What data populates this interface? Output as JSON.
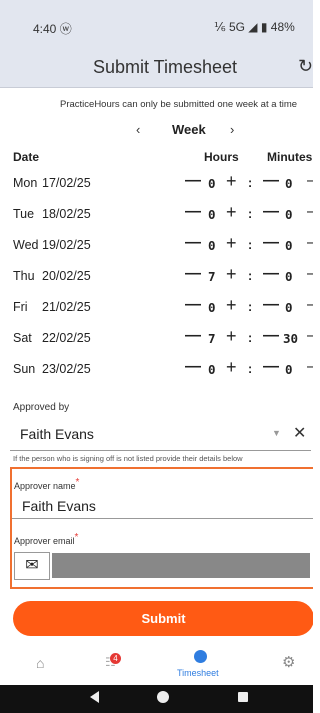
{
  "status_bar": {
    "time": "4:40 ⓦ",
    "right": "⅙ 5G ◢ ▮ 48%"
  },
  "app_bar": {
    "title": "Submit Timesheet",
    "refresh_icon": "↻"
  },
  "notice": "PracticeHours can only be submitted one week at a time",
  "week_nav": {
    "prev": "‹",
    "label": "Week",
    "next": "›"
  },
  "columns": {
    "date": "Date",
    "hours": "Hours",
    "minutes": "Minutes"
  },
  "controls": {
    "minus": "—",
    "plus": "+",
    "colon": ":"
  },
  "rows": [
    {
      "day": "Mon",
      "date": "17/02/25",
      "hours": "0",
      "minutes": "0"
    },
    {
      "day": "Tue",
      "date": "18/02/25",
      "hours": "0",
      "minutes": "0"
    },
    {
      "day": "Wed",
      "date": "19/02/25",
      "hours": "0",
      "minutes": "0"
    },
    {
      "day": "Thu",
      "date": "20/02/25",
      "hours": "7",
      "minutes": "0"
    },
    {
      "day": "Fri",
      "date": "21/02/25",
      "hours": "0",
      "minutes": "0"
    },
    {
      "day": "Sat",
      "date": "22/02/25",
      "hours": "7",
      "minutes": "30"
    },
    {
      "day": "Sun",
      "date": "23/02/25",
      "hours": "0",
      "minutes": "0"
    }
  ],
  "approved_by": {
    "label": "Approved by",
    "value": "Faith Evans",
    "dropdown_icon": "▼",
    "clear_icon": "✕",
    "hint": "If the person who is signing off is not listed provide their details below"
  },
  "approver": {
    "name_label": "Approver name",
    "required_mark": "*",
    "name_value": "Faith Evans",
    "email_label": "Approver email",
    "email_icon": "✉",
    "email_value": ""
  },
  "submit_label": "Submit",
  "bottom_nav": {
    "badge_count": "4",
    "timesheet_label": "Timesheet",
    "home_icon": "⌂",
    "tasks_icon": "☷",
    "gear_icon": "⚙"
  },
  "colors": {
    "accent": "#ff5a14",
    "active_nav": "#2f7de0",
    "app_bar": "#e2e6ef",
    "highlight_border": "#f07030"
  }
}
